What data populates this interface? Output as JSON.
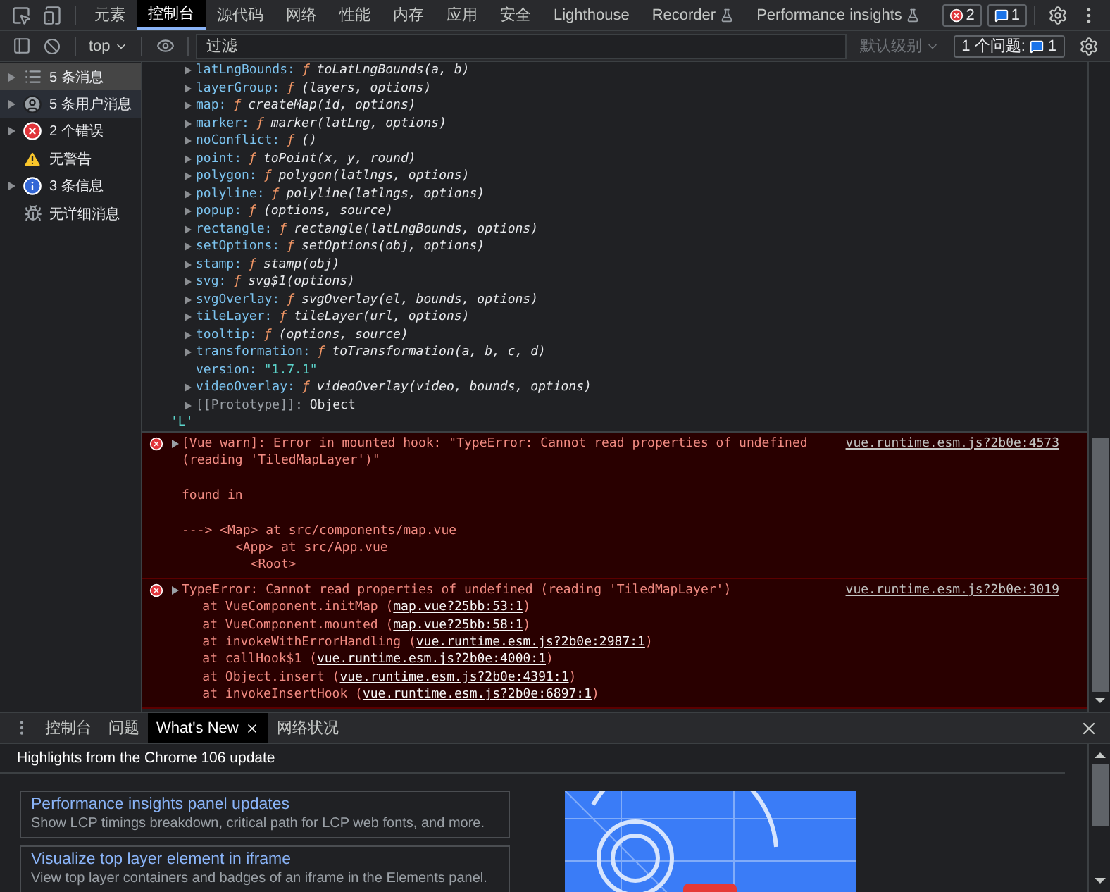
{
  "tabs": [
    {
      "label": "元素",
      "selected": false,
      "experimental": false
    },
    {
      "label": "控制台",
      "selected": true,
      "experimental": false
    },
    {
      "label": "源代码",
      "selected": false,
      "experimental": false
    },
    {
      "label": "网络",
      "selected": false,
      "experimental": false
    },
    {
      "label": "性能",
      "selected": false,
      "experimental": false
    },
    {
      "label": "内存",
      "selected": false,
      "experimental": false
    },
    {
      "label": "应用",
      "selected": false,
      "experimental": false
    },
    {
      "label": "安全",
      "selected": false,
      "experimental": false
    },
    {
      "label": "Lighthouse",
      "selected": false,
      "experimental": false
    },
    {
      "label": "Recorder",
      "selected": false,
      "experimental": true
    },
    {
      "label": "Performance insights",
      "selected": false,
      "experimental": true
    }
  ],
  "counters": {
    "errors": "2",
    "messages": "1"
  },
  "toolbar": {
    "context": "top",
    "filter": {
      "placeholder": "过滤"
    },
    "levels": "默认级别",
    "issues": {
      "label": "1 个问题:",
      "count": "1"
    }
  },
  "sidebar": [
    {
      "kind": "messages",
      "label": "5 条消息",
      "expandable": true,
      "selected": true,
      "hovered": false
    },
    {
      "kind": "user",
      "label": "5 条用户消息",
      "expandable": true,
      "selected": false,
      "hovered": true
    },
    {
      "kind": "error",
      "label": "2 个错误",
      "expandable": true,
      "selected": false,
      "hovered": false
    },
    {
      "kind": "warning",
      "label": "无警告",
      "expandable": false,
      "selected": false,
      "hovered": false
    },
    {
      "kind": "info",
      "label": "3 条信息",
      "expandable": true,
      "selected": false,
      "hovered": false
    },
    {
      "kind": "verbose",
      "label": "无详细消息",
      "expandable": false,
      "selected": false,
      "hovered": false
    }
  ],
  "console": {
    "properties": [
      {
        "kind": "function",
        "name": "latLngBounds:",
        "sign": "ƒ",
        "value": "toLatLngBounds(a, b)"
      },
      {
        "kind": "function",
        "name": "layerGroup:",
        "sign": "ƒ",
        "value": "(layers, options)"
      },
      {
        "kind": "function",
        "name": "map:",
        "sign": "ƒ",
        "value": "createMap(id, options)"
      },
      {
        "kind": "function",
        "name": "marker:",
        "sign": "ƒ",
        "value": "marker(latLng, options)"
      },
      {
        "kind": "function",
        "name": "noConflict:",
        "sign": "ƒ",
        "value": "()"
      },
      {
        "kind": "function",
        "name": "point:",
        "sign": "ƒ",
        "value": "toPoint(x, y, round)"
      },
      {
        "kind": "function",
        "name": "polygon:",
        "sign": "ƒ",
        "value": "polygon(latlngs, options)"
      },
      {
        "kind": "function",
        "name": "polyline:",
        "sign": "ƒ",
        "value": "polyline(latlngs, options)"
      },
      {
        "kind": "function",
        "name": "popup:",
        "sign": "ƒ",
        "value": "(options, source)"
      },
      {
        "kind": "function",
        "name": "rectangle:",
        "sign": "ƒ",
        "value": "rectangle(latLngBounds, options)"
      },
      {
        "kind": "function",
        "name": "setOptions:",
        "sign": "ƒ",
        "value": "setOptions(obj, options)"
      },
      {
        "kind": "function",
        "name": "stamp:",
        "sign": "ƒ",
        "value": "stamp(obj)"
      },
      {
        "kind": "function",
        "name": "svg:",
        "sign": "ƒ",
        "value": "svg$1(options)"
      },
      {
        "kind": "function",
        "name": "svgOverlay:",
        "sign": "ƒ",
        "value": "svgOverlay(el, bounds, options)"
      },
      {
        "kind": "function",
        "name": "tileLayer:",
        "sign": "ƒ",
        "value": "tileLayer(url, options)"
      },
      {
        "kind": "function",
        "name": "tooltip:",
        "sign": "ƒ",
        "value": "(options, source)"
      },
      {
        "kind": "function",
        "name": "transformation:",
        "sign": "ƒ",
        "value": "toTransformation(a, b, c, d)"
      },
      {
        "kind": "string",
        "name": "version:",
        "value": "\"1.7.1\""
      },
      {
        "kind": "function",
        "name": "videoOverlay:",
        "sign": "ƒ",
        "value": "videoOverlay(video, bounds, options)"
      },
      {
        "kind": "object",
        "name": "[[Prototype]]:",
        "value": "Object"
      }
    ],
    "result": "'L'",
    "errors": [
      {
        "message": "[Vue warn]: Error in mounted hook: \"TypeError: Cannot read properties of undefined (reading 'TiledMapLayer')\"\n\nfound in\n\n---> <Map> at src/components/map.vue\n       <App> at src/App.vue\n         <Root>",
        "source": "vue.runtime.esm.js?2b0e:4573"
      },
      {
        "message": "TypeError: Cannot read properties of undefined (reading 'TiledMapLayer')",
        "source": "vue.runtime.esm.js?2b0e:3019",
        "stack": [
          {
            "prefix": "    at VueComponent.initMap (",
            "link": "map.vue?25bb:53:1",
            "suffix": ")"
          },
          {
            "prefix": "    at VueComponent.mounted (",
            "link": "map.vue?25bb:58:1",
            "suffix": ")"
          },
          {
            "prefix": "    at invokeWithErrorHandling (",
            "link": "vue.runtime.esm.js?2b0e:2987:1",
            "suffix": ")"
          },
          {
            "prefix": "    at callHook$1 (",
            "link": "vue.runtime.esm.js?2b0e:4000:1",
            "suffix": ")"
          },
          {
            "prefix": "    at Object.insert (",
            "link": "vue.runtime.esm.js?2b0e:4391:1",
            "suffix": ")"
          },
          {
            "prefix": "    at invokeInsertHook (",
            "link": "vue.runtime.esm.js?2b0e:6897:1",
            "suffix": ")"
          }
        ]
      }
    ]
  },
  "drawer": {
    "tabs": [
      {
        "label": "控制台",
        "selected": false,
        "closable": false
      },
      {
        "label": "问题",
        "selected": false,
        "closable": false
      },
      {
        "label": "What's New",
        "selected": true,
        "closable": true
      },
      {
        "label": "网络状况",
        "selected": false,
        "closable": false
      }
    ],
    "header": "Highlights from the Chrome 106 update",
    "cards": [
      {
        "title": "Performance insights panel updates",
        "description": "Show LCP timings breakdown, critical path for LCP web fonts, and more."
      },
      {
        "title": "Visualize top layer element in iframe",
        "description": "View top layer containers and badges of an iframe in the Elements panel."
      }
    ]
  }
}
